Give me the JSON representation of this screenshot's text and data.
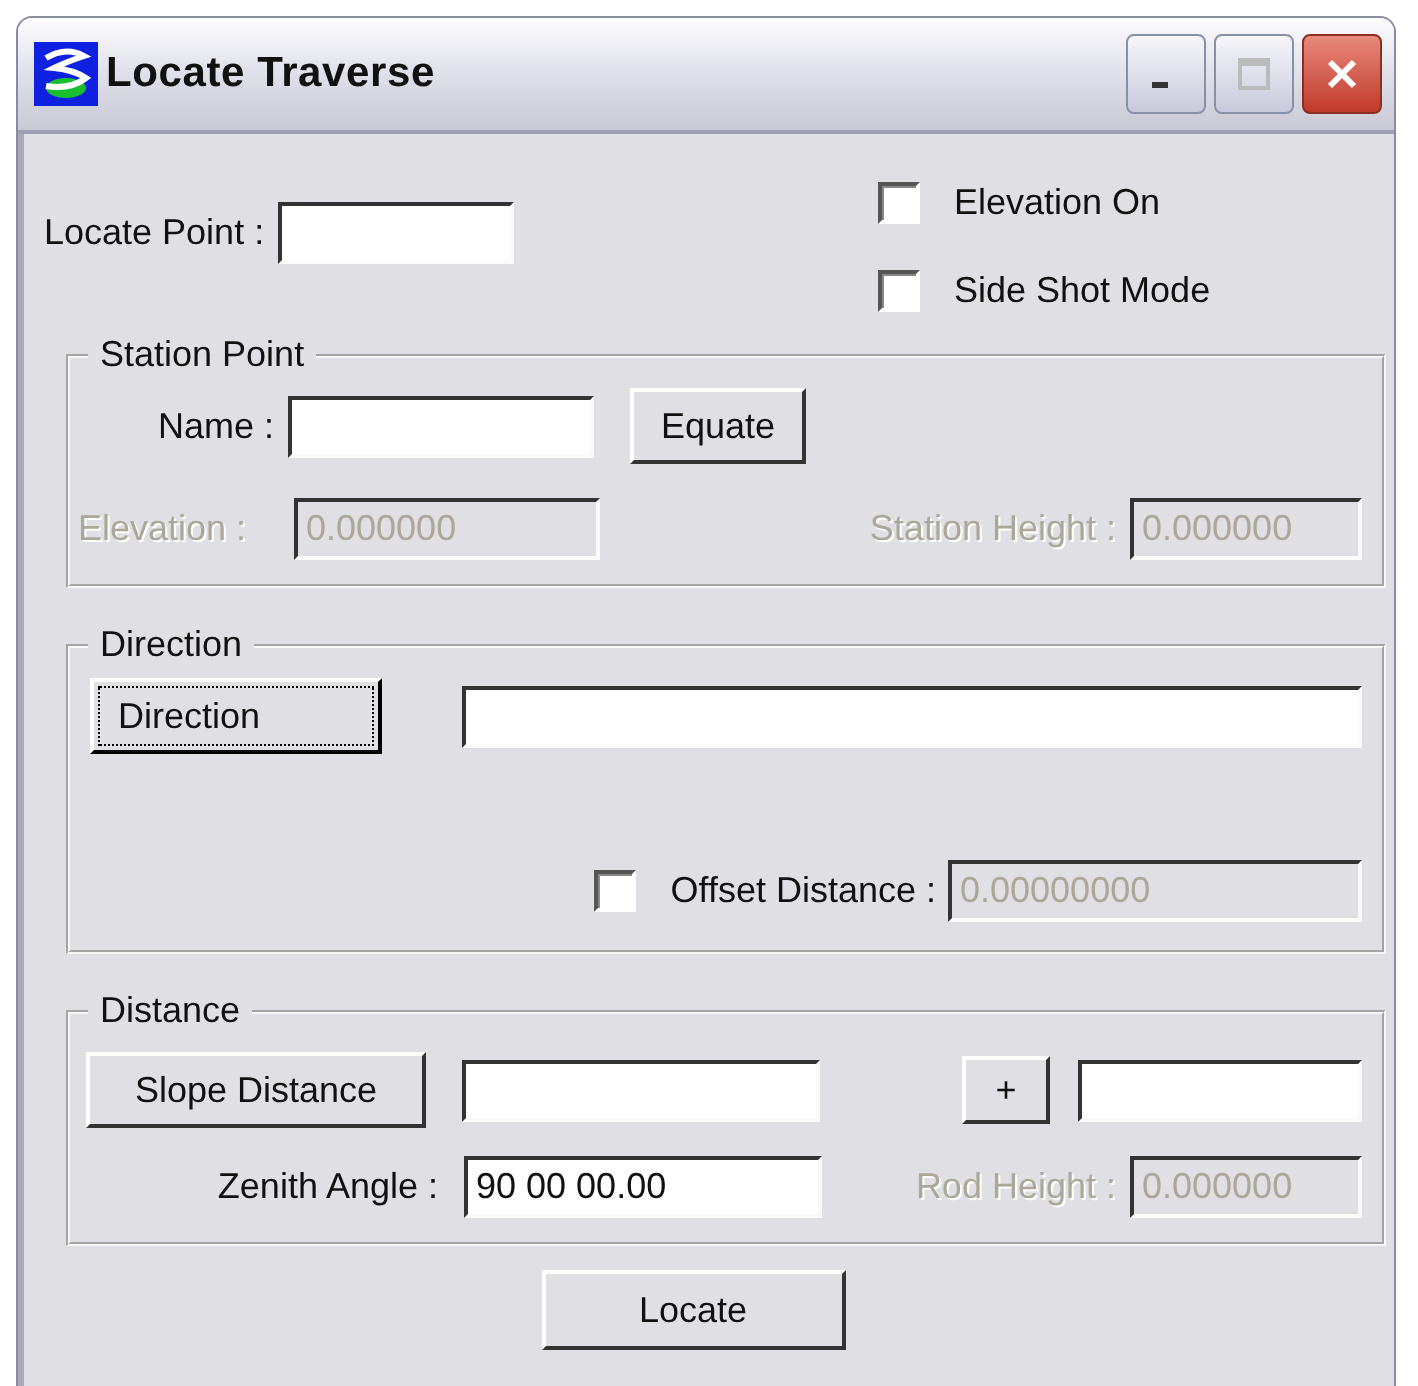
{
  "window": {
    "title": "Locate Traverse"
  },
  "locate_point": {
    "label": "Locate Point :"
  },
  "options": [
    {
      "label": "Elevation On",
      "checked": false
    },
    {
      "label": "Side Shot Mode",
      "checked": false
    }
  ],
  "station_point": {
    "title": "Station Point",
    "name_label": "Name :",
    "equate_button": "Equate",
    "elevation": {
      "label": "Elevation :",
      "value": "0.000000",
      "disabled": true
    },
    "station_height": {
      "label": "Station Height :",
      "value": "0.000000",
      "disabled": true
    }
  },
  "direction": {
    "title": "Direction",
    "button": {
      "label": "Direction",
      "focused": true
    },
    "offset": {
      "checked": false,
      "label": "Offset Distance :",
      "value": "0.00000000",
      "disabled": true
    }
  },
  "distance": {
    "title": "Distance",
    "slope_button": "Slope Distance",
    "plus_button": "+",
    "zenith": {
      "label": "Zenith Angle :",
      "value": "90 00 00.00",
      "disabled": false
    },
    "rod_height": {
      "label": "Rod Height :",
      "value": "0.000000",
      "disabled": true
    }
  },
  "locate_button": "Locate"
}
